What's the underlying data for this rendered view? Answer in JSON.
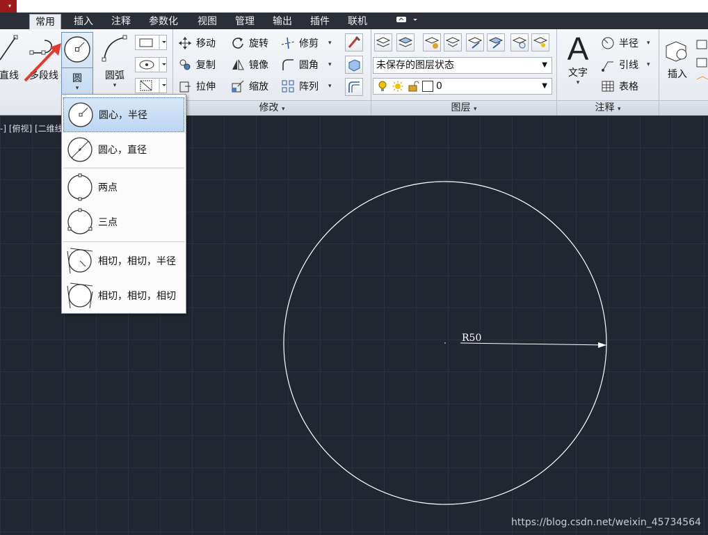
{
  "tabs": [
    "常用",
    "插入",
    "注释",
    "参数化",
    "视图",
    "管理",
    "输出",
    "插件",
    "联机"
  ],
  "active_tab": "常用",
  "draw_panel": {
    "line_label": "直线",
    "polyline_label": "多段线",
    "circle_label": "圆",
    "arc_label": "圆弧"
  },
  "modify_panel": {
    "title": "修改",
    "items": [
      {
        "label": "移动"
      },
      {
        "label": "旋转"
      },
      {
        "label": "修剪"
      },
      {
        "label": "复制"
      },
      {
        "label": "镜像"
      },
      {
        "label": "圆角"
      },
      {
        "label": "拉伸"
      },
      {
        "label": "缩放"
      },
      {
        "label": "阵列"
      }
    ]
  },
  "layers_panel": {
    "title": "图层",
    "layer_state": "未保存的图层状态",
    "current_layer": "0"
  },
  "annotation_panel": {
    "title": "注释",
    "text_label": "文字",
    "items": [
      {
        "label": "半径"
      },
      {
        "label": "引线"
      },
      {
        "label": "表格"
      }
    ]
  },
  "block_panel": {
    "insert_label": "插入"
  },
  "viewport_label": "-] [俯视] [二维线",
  "circle_dropdown": {
    "items": [
      {
        "label": "圆心，半径",
        "selected": true
      },
      {
        "label": "圆心，直径",
        "selected": false
      },
      {
        "label": "两点",
        "selected": false
      },
      {
        "label": "三点",
        "selected": false
      },
      {
        "label": "相切，相切，半径",
        "selected": false
      },
      {
        "label": "相切，相切，相切",
        "selected": false
      }
    ]
  },
  "drawing": {
    "dimension_text": "R50",
    "stroke_color": "#ffffff"
  },
  "watermark": "https://blog.csdn.net/weixin_45734564",
  "colors": {
    "viewport_bg": "#212631",
    "tabbar_bg": "#2b2f38",
    "selection": "#bcd6f2",
    "app_button": "#9c1a1a",
    "arrow_annotation": "#e53a2a"
  }
}
